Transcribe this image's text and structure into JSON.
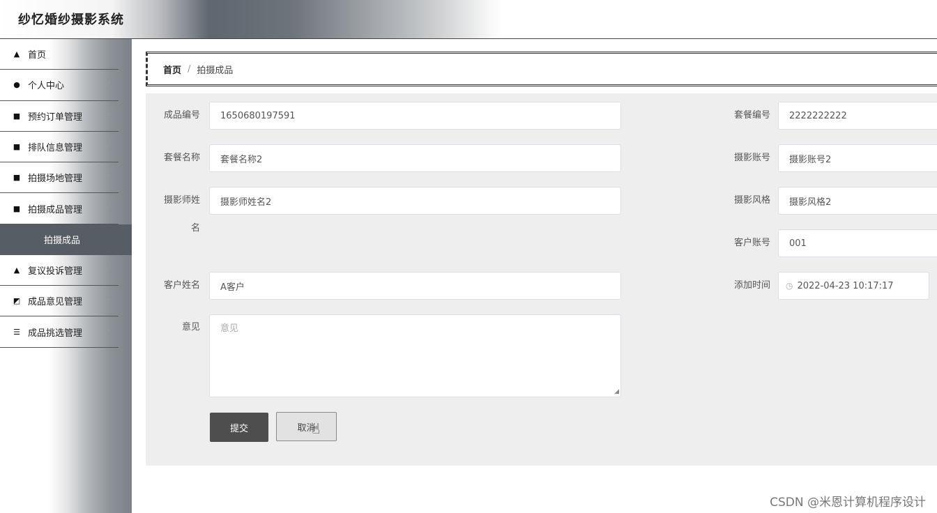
{
  "app": {
    "title": "纱忆婚纱摄影系统"
  },
  "sidebar": {
    "items": [
      {
        "label": "首页",
        "icon": "home-icon",
        "has_chevron": false
      },
      {
        "label": "个人中心",
        "icon": "user-icon",
        "has_chevron": true
      },
      {
        "label": "预约订单管理",
        "icon": "grid-icon",
        "has_chevron": true
      },
      {
        "label": "排队信息管理",
        "icon": "grid-icon",
        "has_chevron": true
      },
      {
        "label": "拍摄场地管理",
        "icon": "grid-icon",
        "has_chevron": true
      },
      {
        "label": "拍摄成品管理",
        "icon": "grid-icon",
        "has_chevron": true
      }
    ],
    "active_sub": "拍摄成品",
    "items_after": [
      {
        "label": "复议投诉管理",
        "icon": "user-icon",
        "has_chevron": true
      },
      {
        "label": "成品意见管理",
        "icon": "chart-icon",
        "has_chevron": true
      },
      {
        "label": "成品挑选管理",
        "icon": "list-icon",
        "has_chevron": true
      }
    ]
  },
  "breadcrumb": {
    "home": "首页",
    "separator": "/",
    "current": "拍摄成品"
  },
  "form": {
    "product_no": {
      "label": "成品编号",
      "value": "1650680197591"
    },
    "package_no": {
      "label": "套餐编号",
      "value": "2222222222"
    },
    "package_name": {
      "label": "套餐名称",
      "value": "套餐名称2"
    },
    "photo_account": {
      "label": "摄影账号",
      "value": "摄影账号2"
    },
    "photographer_name": {
      "label_line1": "摄影师姓",
      "label_line2": "名",
      "value": "摄影师姓名2"
    },
    "photo_style": {
      "label": "摄影风格",
      "value": "摄影风格2"
    },
    "customer_account": {
      "label": "客户账号",
      "value": "001"
    },
    "customer_name": {
      "label": "客户姓名",
      "value": "A客户"
    },
    "add_time": {
      "label": "添加时间",
      "value": "2022-04-23 10:17:17"
    },
    "opinion": {
      "label": "意见",
      "placeholder": "意见"
    },
    "submit_label": "提交",
    "cancel_label": "取消"
  },
  "watermark": "CSDN @米恩计算机程序设计"
}
